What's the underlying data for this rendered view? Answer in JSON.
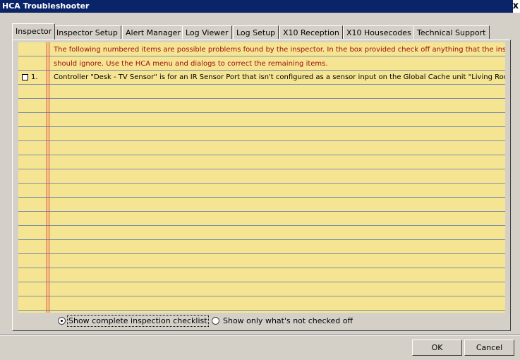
{
  "window": {
    "title": "HCA Troubleshooter",
    "close_glyph": "x"
  },
  "tabs": [
    {
      "label": "Inspector",
      "active": true
    },
    {
      "label": "Inspector Setup",
      "active": false
    },
    {
      "label": "Alert Manager",
      "active": false
    },
    {
      "label": "Log Viewer",
      "active": false
    },
    {
      "label": "Log Setup",
      "active": false
    },
    {
      "label": "X10 Reception",
      "active": false
    },
    {
      "label": "X10 Housecodes",
      "active": false
    },
    {
      "label": "Technical Support",
      "active": false
    }
  ],
  "inspector": {
    "intro_line1": "The following numbered items are possible problems found by the inspector. In the box provided check off anything that the inspector",
    "intro_line2": "should ignore. Use the HCA menu and dialogs to correct the remaining items.",
    "items": [
      {
        "number": "1.",
        "checked": false,
        "text": "Controller \"Desk - TV Sensor\" is for an IR Sensor Port that isn't configured as a sensor input on the Global Cache unit \"Living Room IR\"."
      }
    ]
  },
  "options": {
    "show_complete": "Show complete inspection checklist",
    "show_unchecked": "Show only what's not checked off",
    "selected": "show_complete"
  },
  "buttons": {
    "ok": "OK",
    "cancel": "Cancel"
  },
  "colors": {
    "paper": "#f5e592",
    "margin_line": "#dd3333",
    "intro_text": "#a01010",
    "titlebar": "#0a246a"
  }
}
